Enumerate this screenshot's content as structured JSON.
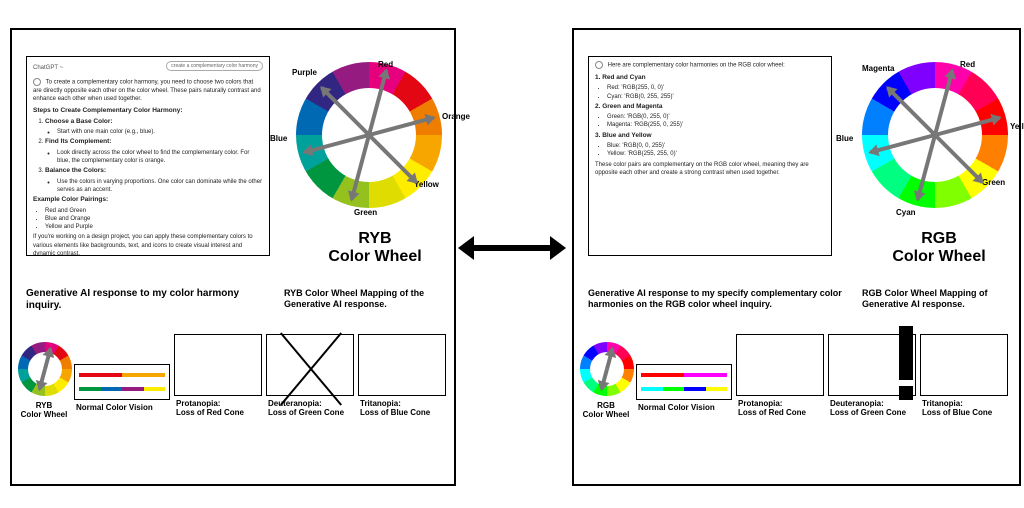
{
  "left": {
    "chat": {
      "header": "ChatGPT ~",
      "pill": "create a complementary color harmony",
      "intro": "To create a complementary color harmony, you need to choose two colors that are directly opposite each other on the color wheel. These pairs naturally contrast and enhance each other when used together.",
      "steps_title": "Steps to Create Complementary Color Harmony:",
      "step1_title": "Choose a Base Color:",
      "step1_body": "Start with one main color (e.g., blue).",
      "step2_title": "Find Its Complement:",
      "step2_body": "Look directly across the color wheel to find the complementary color. For blue, the complementary color is orange.",
      "step3_title": "Balance the Colors:",
      "step3_body": "Use the colors in varying proportions. One color can dominate while the other serves as an accent.",
      "pairings_title": "Example Color Pairings:",
      "pair1": "Red and Green",
      "pair2": "Blue and Orange",
      "pair3": "Yellow and Purple",
      "outro": "If you're working on a design project, you can apply these complementary colors to various elements like backgrounds, text, and icons to create visual interest and dynamic contrast."
    },
    "wheel_title": "RYB\nColor Wheel",
    "wheel_labels": {
      "red": "Red",
      "orange": "Orange",
      "yellow": "Yellow",
      "green": "Green",
      "blue": "Blue",
      "purple": "Purple"
    },
    "cap1": "Generative AI response to my color harmony inquiry.",
    "cap2": "RYB Color Wheel Mapping of the Generative AI response.",
    "mini_wheel_label": "RYB\nColor Wheel",
    "thumbs": {
      "normal": "Normal Color Vision",
      "prot": "Protanopia:\nLoss of Red Cone",
      "deut": "Deuteranopia:\nLoss of Green Cone",
      "trit": "Tritanopia:\nLoss of Blue Cone"
    },
    "colors": {
      "ring": [
        "#e6007e",
        "#e30613",
        "#ef7d00",
        "#f7a600",
        "#ffed00",
        "#dedc00",
        "#95c11f",
        "#009640",
        "#00a19a",
        "#0069b4",
        "#312783",
        "#951b81"
      ],
      "normal_top": [
        "#e30613",
        "#f7a600"
      ],
      "normal_bot": [
        "#009640",
        "#0069b4",
        "#951b81",
        "#ffed00"
      ],
      "prot": [
        "#8a7d2d",
        "#b0a23a",
        "#5e5e5e",
        "#3a3a9a"
      ],
      "deut": [
        "#9a8533",
        "#b5a23a",
        "#6a6a6a",
        "#3a3aa0"
      ],
      "trit": [
        "#c05a5a",
        "#d88a2f",
        "#2f7d7d",
        "#6a4a4a"
      ]
    }
  },
  "right": {
    "chat": {
      "intro": "Here are complementary color harmonies on the RGB color wheel:",
      "h1": "1. Red and Cyan",
      "l1a": "Red: 'RGB(255, 0, 0)'",
      "l1b": "Cyan: 'RGB(0, 255, 255)'",
      "h2": "2. Green and Magenta",
      "l2a": "Green: 'RGB(0, 255, 0)'",
      "l2b": "Magenta: 'RGB(255, 0, 255)'",
      "h3": "3. Blue and Yellow",
      "l3a": "Blue: 'RGB(0, 0, 255)'",
      "l3b": "Yellow: 'RGB(255, 255, 0)'",
      "outro": "These color pairs are complementary on the RGB color wheel, meaning they are opposite each other and create a strong contrast when used together."
    },
    "wheel_title": "RGB\nColor Wheel",
    "wheel_labels": {
      "red": "Red",
      "yellow": "Yellow",
      "green": "Green",
      "cyan": "Cyan",
      "blue": "Blue",
      "magenta": "Magenta"
    },
    "cap1": "Generative AI response to my specify complementary color harmonies on the RGB color wheel inquiry.",
    "cap2": "RGB Color Wheel Mapping of Generative AI response.",
    "mini_wheel_label": "RGB\nColor Wheel",
    "thumbs": {
      "normal": "Normal Color Vision",
      "prot": "Protanopia:\nLoss of Red Cone",
      "deut": "Deuteranopia:\nLoss of Green Cone",
      "trit": "Tritanopia:\nLoss of Blue Cone"
    },
    "colors": {
      "ring": [
        "#ff00aa",
        "#ff0055",
        "#ff0000",
        "#ff8000",
        "#ffff00",
        "#80ff00",
        "#00ff00",
        "#00ff80",
        "#00ffff",
        "#0080ff",
        "#0000ff",
        "#8000ff"
      ],
      "normal_top": [
        "#ff0000",
        "#ff00ff"
      ],
      "normal_bot": [
        "#00ffff",
        "#00ff00",
        "#0000ff",
        "#ffff00"
      ],
      "prot": [
        "#8a7d2d",
        "#b0a23a",
        "#5e5e9a",
        "#b9b93a"
      ],
      "deut": [
        "#9a8533",
        "#b5a23a",
        "#5a5aa0",
        "#c0c040"
      ],
      "trit": [
        "#c05a5a",
        "#d88a2f",
        "#2f7d7d",
        "#6a4a4a"
      ]
    }
  }
}
